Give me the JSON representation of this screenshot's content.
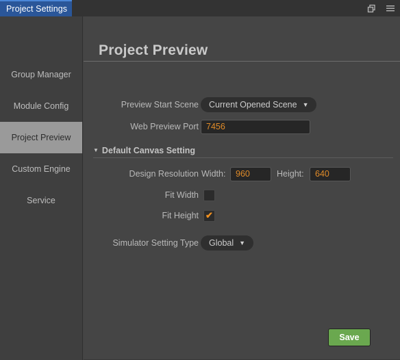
{
  "window": {
    "tab_label": "Project Settings",
    "restore_icon": "restore-window-icon",
    "menu_icon": "hamburger-menu-icon"
  },
  "sidebar": {
    "items": [
      {
        "label": "Group Manager",
        "selected": false
      },
      {
        "label": "Module Config",
        "selected": false
      },
      {
        "label": "Project Preview",
        "selected": true
      },
      {
        "label": "Custom Engine",
        "selected": false
      },
      {
        "label": "Service",
        "selected": false
      }
    ]
  },
  "main": {
    "title": "Project Preview",
    "preview_start_scene": {
      "label": "Preview Start Scene",
      "value": "Current Opened Scene",
      "caret": "▼"
    },
    "web_preview_port": {
      "label": "Web Preview Port",
      "value": "7456"
    },
    "default_canvas_setting": {
      "triangle": "▼",
      "label": "Default Canvas Setting",
      "design_resolution": {
        "label": "Design Resolution",
        "width_label": "Width:",
        "width_value": "960",
        "height_label": "Height:",
        "height_value": "640"
      },
      "fit_width": {
        "label": "Fit Width",
        "checked": false,
        "tick": ""
      },
      "fit_height": {
        "label": "Fit Height",
        "checked": true,
        "tick": "✔"
      }
    },
    "simulator_setting_type": {
      "label": "Simulator Setting Type",
      "value": "Global",
      "caret": "▼"
    },
    "save_label": "Save"
  },
  "colors": {
    "tab_accent": "#2a5699",
    "tab_top_border": "#4a87d8",
    "input_text": "#e08b28",
    "checkbox_tick": "#f09020",
    "save_button": "#6aa84f",
    "selected_sidebar": "#9a9a9a"
  }
}
